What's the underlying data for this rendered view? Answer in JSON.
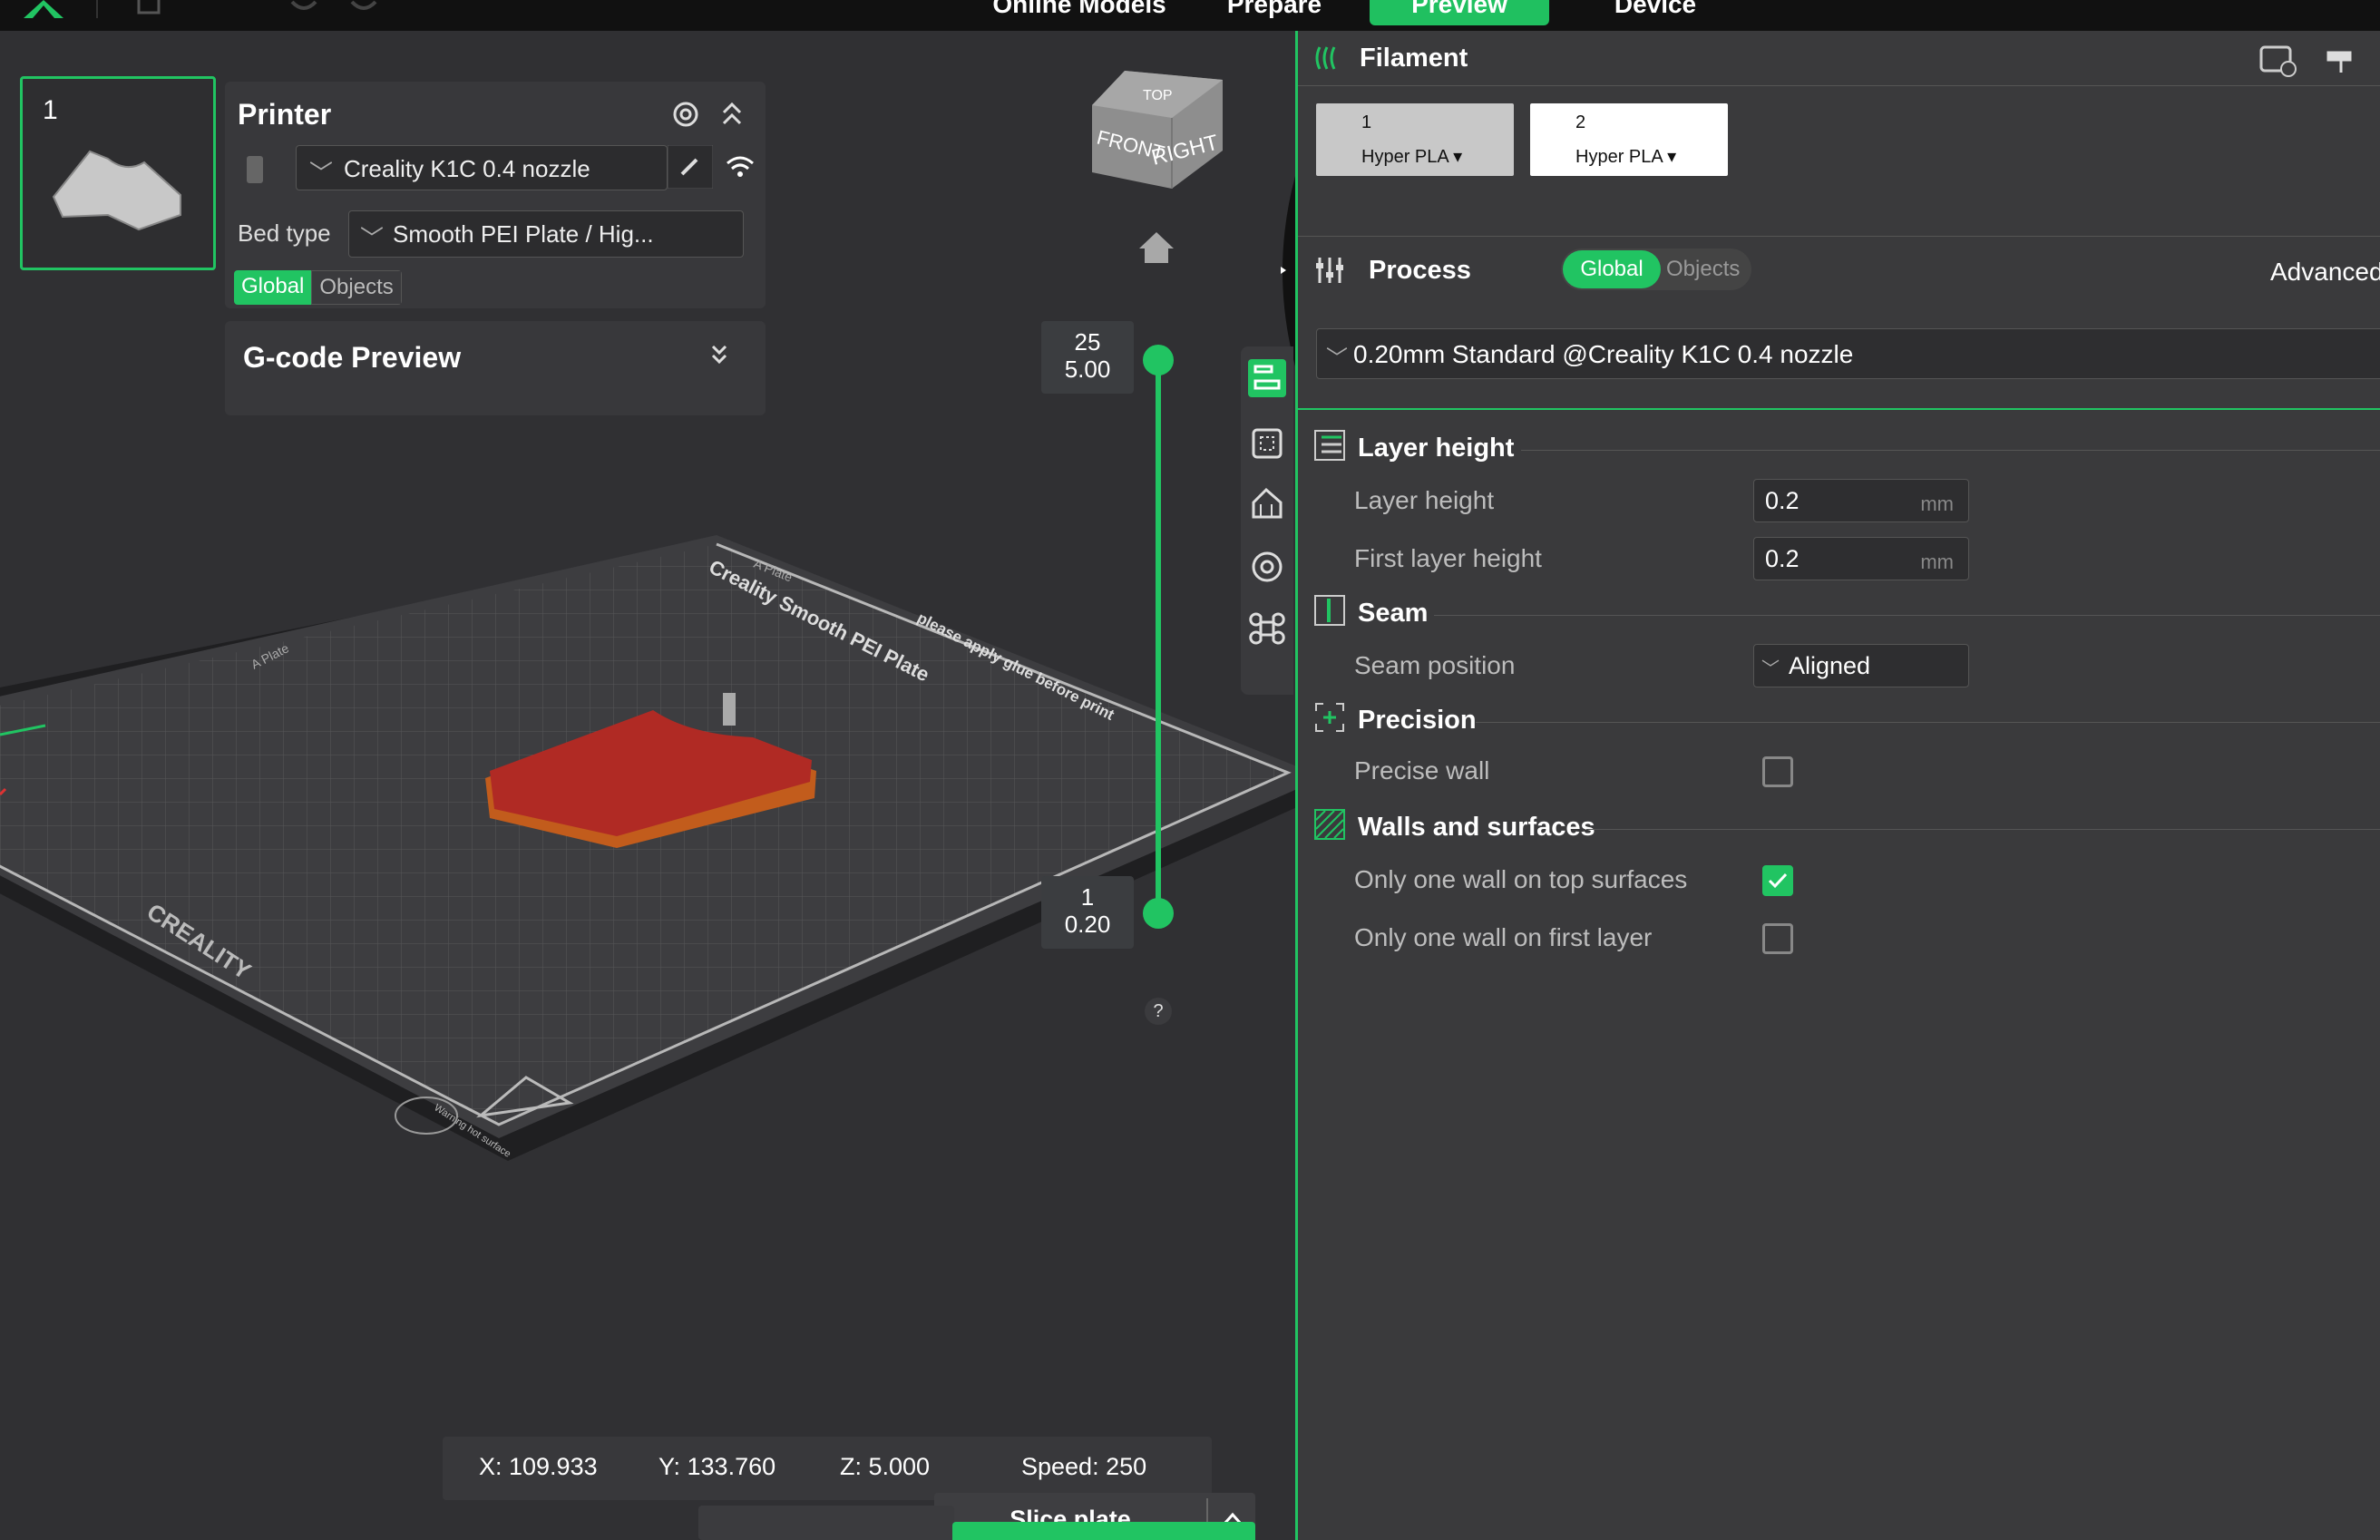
{
  "topbar": {
    "tabs": [
      {
        "label": "Online Models"
      },
      {
        "label": "Prepare"
      },
      {
        "label": "Preview",
        "active": true
      },
      {
        "label": "Device"
      }
    ]
  },
  "plate": {
    "number": "1"
  },
  "printer": {
    "title": "Printer",
    "printer_name": "Creality K1C 0.4 nozzle",
    "bed_type_label": "Bed type",
    "bed_type_value": "Smooth PEI Plate / Hig...",
    "scope_global": "Global",
    "scope_objects": "Objects"
  },
  "gcode_preview": {
    "title": "G-code Preview"
  },
  "view_cube": {
    "top": "TOP",
    "front": "FRONT",
    "right": "RIGHT"
  },
  "layer_slider": {
    "top_layer": "25",
    "top_height": "5.00",
    "bottom_layer": "1",
    "bottom_height": "0.20"
  },
  "help": {
    "label": "?"
  },
  "coords": {
    "x": "X: 109.933",
    "y": "Y: 133.760",
    "z": "Z: 5.000",
    "speed": "Speed: 250"
  },
  "slice": {
    "label": "Slice plate"
  },
  "filament": {
    "title": "Filament",
    "slots": [
      {
        "num": "1",
        "type": "Hyper PLA",
        "color": "#c8c8c8"
      },
      {
        "num": "2",
        "type": "Hyper PLA",
        "color": "#ffffff"
      }
    ]
  },
  "process": {
    "title": "Process",
    "scope_global": "Global",
    "scope_objects": "Objects",
    "advanced": "Advanced",
    "profile": "0.20mm Standard @Creality K1C 0.4 nozzle"
  },
  "sections": {
    "layer_height": {
      "title": "Layer height",
      "layer_height_label": "Layer height",
      "layer_height_value": "0.2",
      "first_layer_label": "First layer height",
      "first_layer_value": "0.2",
      "unit": "mm"
    },
    "seam": {
      "title": "Seam",
      "position_label": "Seam position",
      "position_value": "Aligned"
    },
    "precision": {
      "title": "Precision",
      "precise_wall_label": "Precise wall",
      "precise_wall_checked": false
    },
    "walls": {
      "title": "Walls and surfaces",
      "one_wall_top_label": "Only one wall on top surfaces",
      "one_wall_top_checked": true,
      "one_wall_first_label": "Only one wall on first layer",
      "one_wall_first_checked": false
    }
  },
  "bed": {
    "brand": "CREALITY",
    "plate_name": "Creality Smooth PEI Plate",
    "glue_note": "please apply glue before print",
    "warning": "Warning hot surface",
    "plate_tag": "A Plate",
    "plate_tag_2": "A Plate"
  },
  "colors": {
    "accent": "#21c462",
    "model": "#b02a24",
    "model_edge": "#d4651e"
  }
}
